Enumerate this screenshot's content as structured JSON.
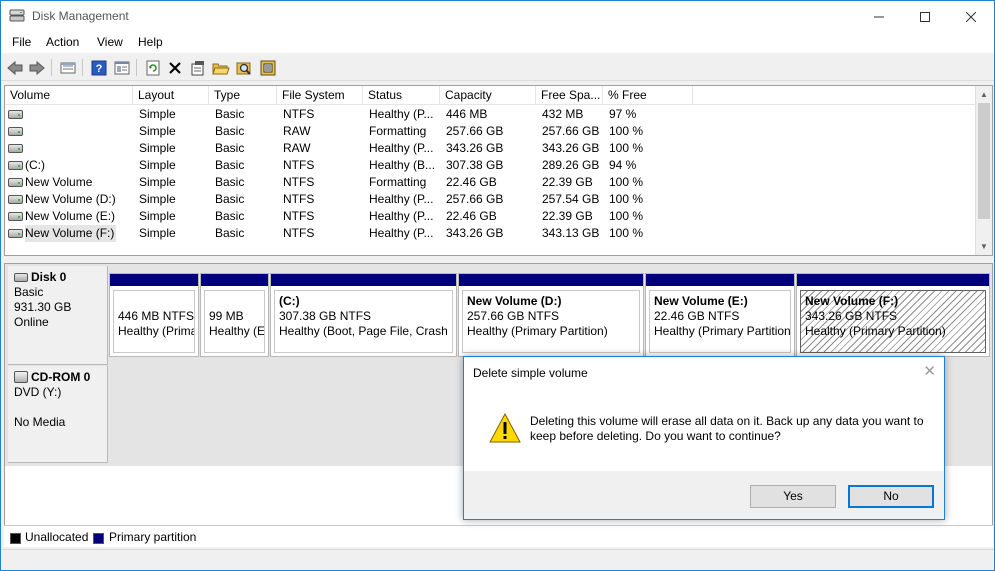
{
  "window": {
    "title": "Disk Management"
  },
  "menu": [
    "File",
    "Action",
    "View",
    "Help"
  ],
  "toolbar": {
    "icons": [
      "back-icon",
      "forward-icon",
      "disk-list-icon",
      "help-icon",
      "properties-view-icon",
      "refresh-icon",
      "delete-icon",
      "properties-icon",
      "open-icon",
      "explore-icon",
      "settings-icon"
    ]
  },
  "columns": [
    "Volume",
    "Layout",
    "Type",
    "File System",
    "Status",
    "Capacity",
    "Free Spa...",
    "% Free"
  ],
  "volumes": [
    {
      "volume": "",
      "layout": "Simple",
      "type": "Basic",
      "fs": "NTFS",
      "status": "Healthy (P...",
      "capacity": "446 MB",
      "free": "432 MB",
      "pct": "97 %"
    },
    {
      "volume": "",
      "layout": "Simple",
      "type": "Basic",
      "fs": "RAW",
      "status": "Formatting",
      "capacity": "257.66 GB",
      "free": "257.66 GB",
      "pct": "100 %"
    },
    {
      "volume": "",
      "layout": "Simple",
      "type": "Basic",
      "fs": "RAW",
      "status": "Healthy (P...",
      "capacity": "343.26 GB",
      "free": "343.26 GB",
      "pct": "100 %"
    },
    {
      "volume": "(C:)",
      "layout": "Simple",
      "type": "Basic",
      "fs": "NTFS",
      "status": "Healthy (B...",
      "capacity": "307.38 GB",
      "free": "289.26 GB",
      "pct": "94 %"
    },
    {
      "volume": "New Volume",
      "layout": "Simple",
      "type": "Basic",
      "fs": "NTFS",
      "status": "Formatting",
      "capacity": "22.46 GB",
      "free": "22.39 GB",
      "pct": "100 %"
    },
    {
      "volume": "New Volume (D:)",
      "layout": "Simple",
      "type": "Basic",
      "fs": "NTFS",
      "status": "Healthy (P...",
      "capacity": "257.66 GB",
      "free": "257.54 GB",
      "pct": "100 %"
    },
    {
      "volume": "New Volume (E:)",
      "layout": "Simple",
      "type": "Basic",
      "fs": "NTFS",
      "status": "Healthy (P...",
      "capacity": "22.46 GB",
      "free": "22.39 GB",
      "pct": "100 %"
    },
    {
      "volume": "New Volume (F:)",
      "layout": "Simple",
      "type": "Basic",
      "fs": "NTFS",
      "status": "Healthy (P...",
      "capacity": "343.26 GB",
      "free": "343.13 GB",
      "pct": "100 %"
    }
  ],
  "disk0": {
    "name": "Disk 0",
    "type": "Basic",
    "size": "931.30 GB",
    "state": "Online",
    "partitions": [
      {
        "name": "",
        "size": "446 MB NTFS",
        "status": "Healthy (Primary Partition)"
      },
      {
        "name": "",
        "size": "99 MB",
        "status": "Healthy (EFI System Partition)"
      },
      {
        "name": "(C:)",
        "size": "307.38 GB NTFS",
        "status": "Healthy (Boot, Page File, Crash Dump, Primary Partition)"
      },
      {
        "name": "New Volume  (D:)",
        "size": "257.66 GB NTFS",
        "status": "Healthy (Primary Partition)"
      },
      {
        "name": "New Volume  (E:)",
        "size": "22.46 GB NTFS",
        "status": "Healthy (Primary Partition)"
      },
      {
        "name": "New Volume  (F:)",
        "size": "343.26 GB NTFS",
        "status": "Healthy (Primary Partition)"
      }
    ]
  },
  "cdrom0": {
    "name": "CD-ROM 0",
    "type": "DVD (Y:)",
    "state": "No Media"
  },
  "legend": {
    "unallocated": "Unallocated",
    "primary": "Primary partition",
    "unallocated_color": "#000000",
    "primary_color": "#00007f"
  },
  "dialog": {
    "title": "Delete simple volume",
    "message": "Deleting this volume will erase all data on it. Back up any data you want to keep before deleting. Do you want to continue?",
    "yes": "Yes",
    "no": "No"
  }
}
